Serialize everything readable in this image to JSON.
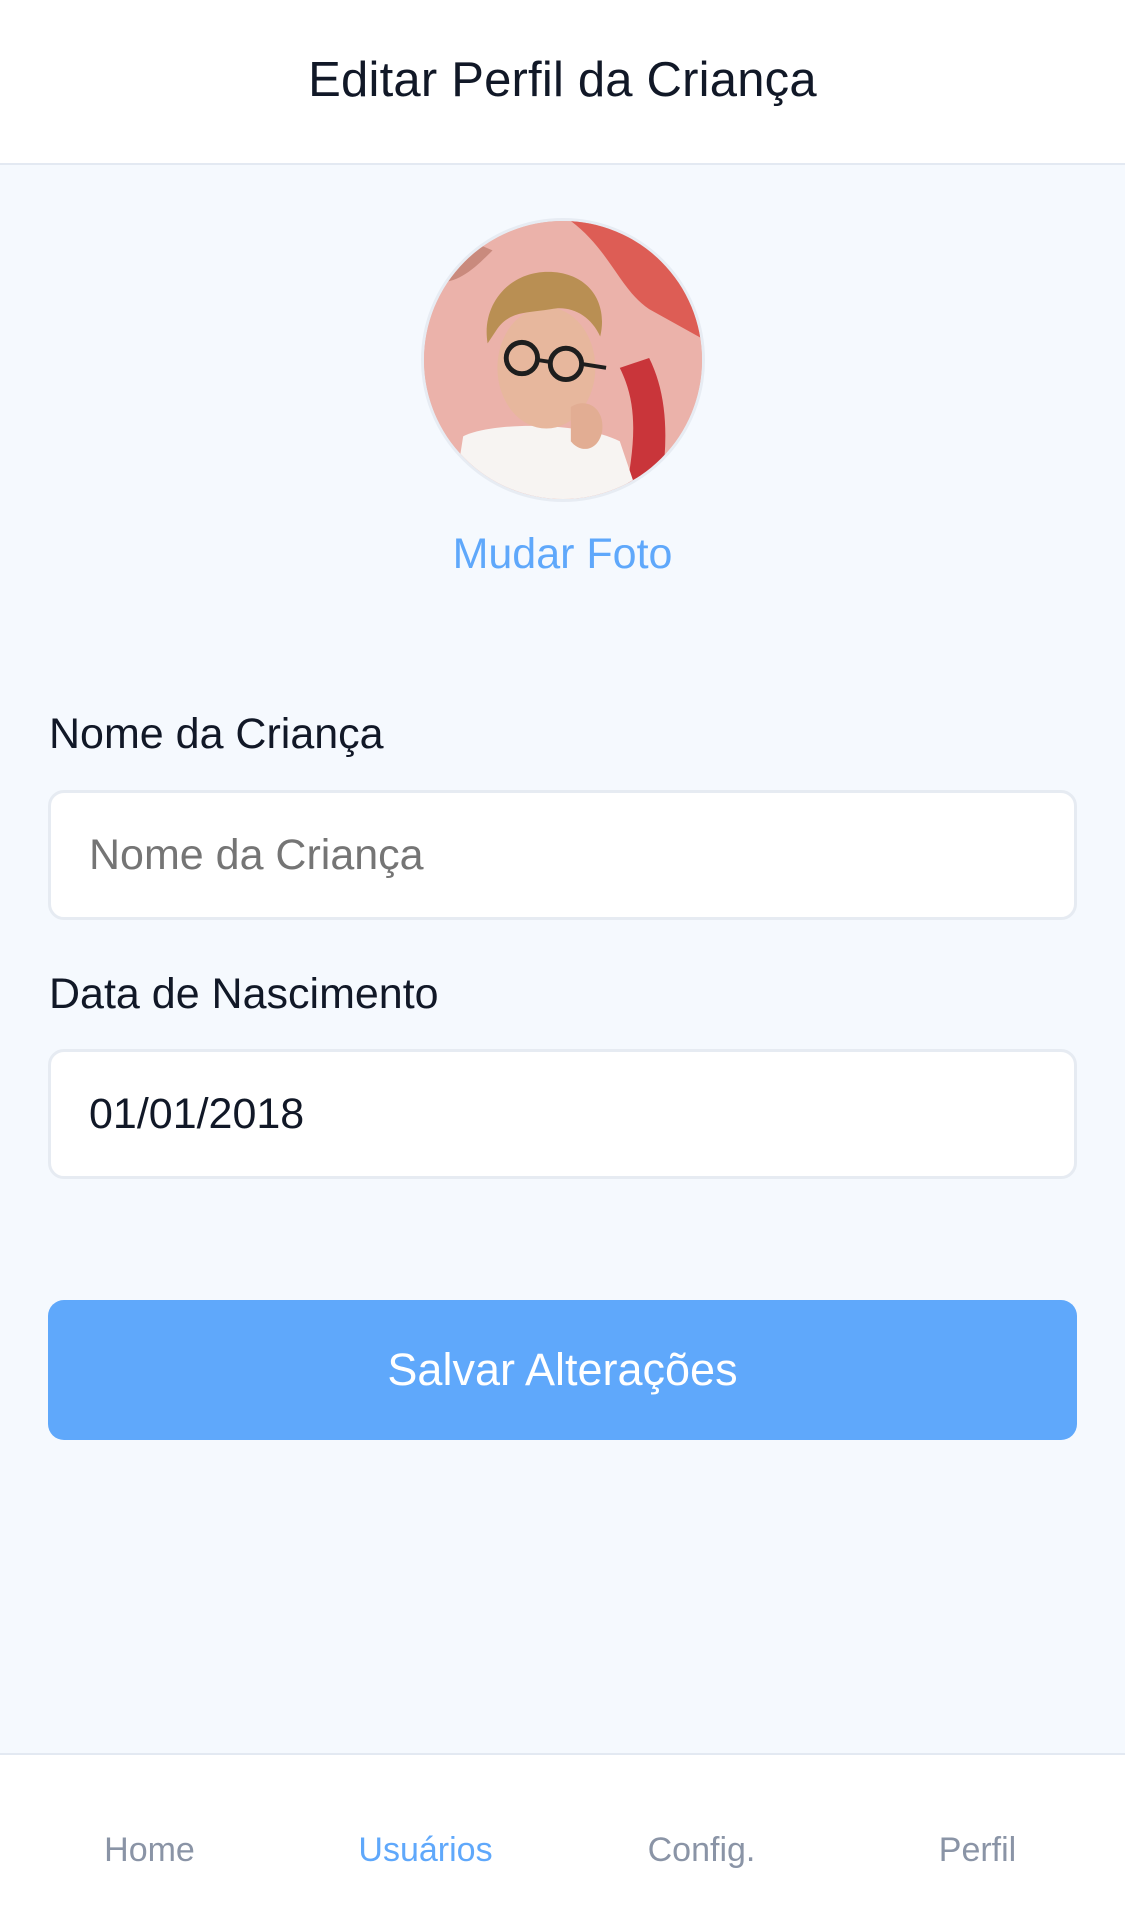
{
  "header": {
    "title": "Editar Perfil da Criança"
  },
  "profile": {
    "change_photo_label": "Mudar Foto"
  },
  "form": {
    "name_label": "Nome da Criança",
    "name_placeholder": "Nome da Criança",
    "name_value": "",
    "birthdate_label": "Data de Nascimento",
    "birthdate_value": "01/01/2018",
    "save_label": "Salvar Alterações"
  },
  "nav": {
    "items": [
      {
        "label": "Home",
        "active": false
      },
      {
        "label": "Usuários",
        "active": true
      },
      {
        "label": "Config.",
        "active": false
      },
      {
        "label": "Perfil",
        "active": false
      }
    ]
  },
  "colors": {
    "accent": "#5fa8fb",
    "background": "#f5f9fe",
    "text": "#111827",
    "nav_inactive": "#8a94a6"
  }
}
